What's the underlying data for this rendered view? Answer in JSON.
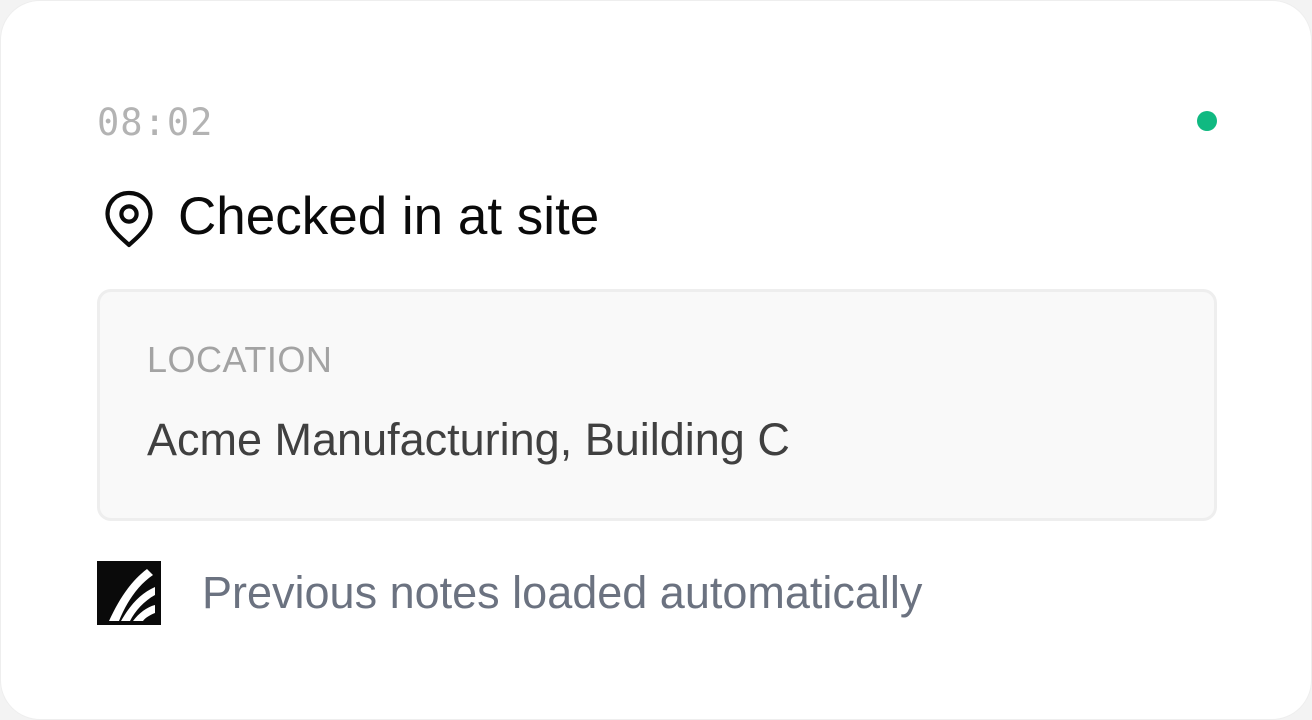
{
  "event": {
    "time": "08:02",
    "status_color": "#10b981",
    "title": "Checked in at site",
    "title_icon": "map-pin-icon"
  },
  "location": {
    "label": "LOCATION",
    "value": "Acme Manufacturing, Building C"
  },
  "footer": {
    "logo_icon": "brand-logo-icon",
    "text": "Previous notes loaded automatically"
  }
}
